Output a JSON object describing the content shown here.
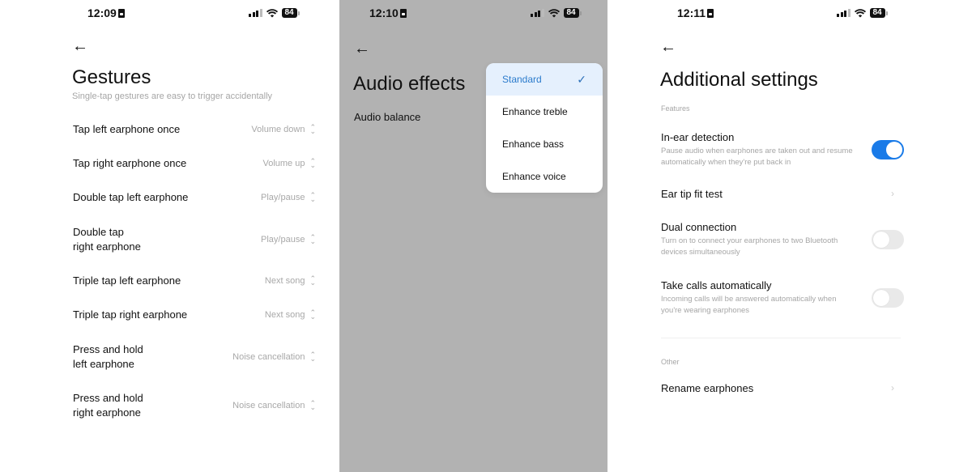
{
  "screens": [
    {
      "status": {
        "time": "12:09",
        "battery": "84"
      },
      "back_icon": "arrow-left",
      "title": "Gestures",
      "subtitle": "Single-tap gestures are easy to trigger accidentally",
      "rows": [
        {
          "label": "Tap left earphone once",
          "value": "Volume down"
        },
        {
          "label": "Tap right earphone once",
          "value": "Volume up"
        },
        {
          "label": "Double tap left earphone",
          "value": "Play/pause"
        },
        {
          "label": "Double tap\nright earphone",
          "value": "Play/pause"
        },
        {
          "label": "Triple tap left earphone",
          "value": "Next song"
        },
        {
          "label": "Triple tap right earphone",
          "value": "Next song"
        },
        {
          "label": "Press and hold\nleft earphone",
          "value": "Noise cancellation"
        },
        {
          "label": "Press and hold\nright earphone",
          "value": "Noise cancellation"
        }
      ]
    },
    {
      "status": {
        "time": "12:10",
        "battery": "84"
      },
      "back_icon": "arrow-left",
      "title": "Audio effects",
      "items": [
        {
          "label": "Audio balance"
        }
      ],
      "dropdown": {
        "options": [
          {
            "label": "Standard",
            "selected": true
          },
          {
            "label": "Enhance treble",
            "selected": false
          },
          {
            "label": "Enhance bass",
            "selected": false
          },
          {
            "label": "Enhance voice",
            "selected": false
          }
        ],
        "check_icon": "checkmark"
      }
    },
    {
      "status": {
        "time": "12:11",
        "battery": "84"
      },
      "back_icon": "arrow-left",
      "title": "Additional settings",
      "sections": [
        {
          "header": "Features",
          "rows": [
            {
              "title": "In-ear detection",
              "desc": "Pause audio when earphones are taken out and resume automatically when they're put back in",
              "control": "toggle",
              "on": true
            },
            {
              "title": "Ear tip fit test",
              "control": "chevron"
            },
            {
              "title": "Dual connection",
              "desc": "Turn on to connect your earphones to two Bluetooth devices simultaneously",
              "control": "toggle",
              "on": false
            },
            {
              "title": "Take calls automatically",
              "desc": "Incoming calls will be answered automatically when you're wearing earphones",
              "control": "toggle",
              "on": false
            }
          ]
        },
        {
          "header": "Other",
          "rows": [
            {
              "title": "Rename earphones",
              "control": "chevron"
            }
          ]
        }
      ]
    }
  ],
  "colors": {
    "accent": "#1a7be8",
    "selected_bg": "#e5f0fd",
    "overlay": "#b2b2b2"
  }
}
